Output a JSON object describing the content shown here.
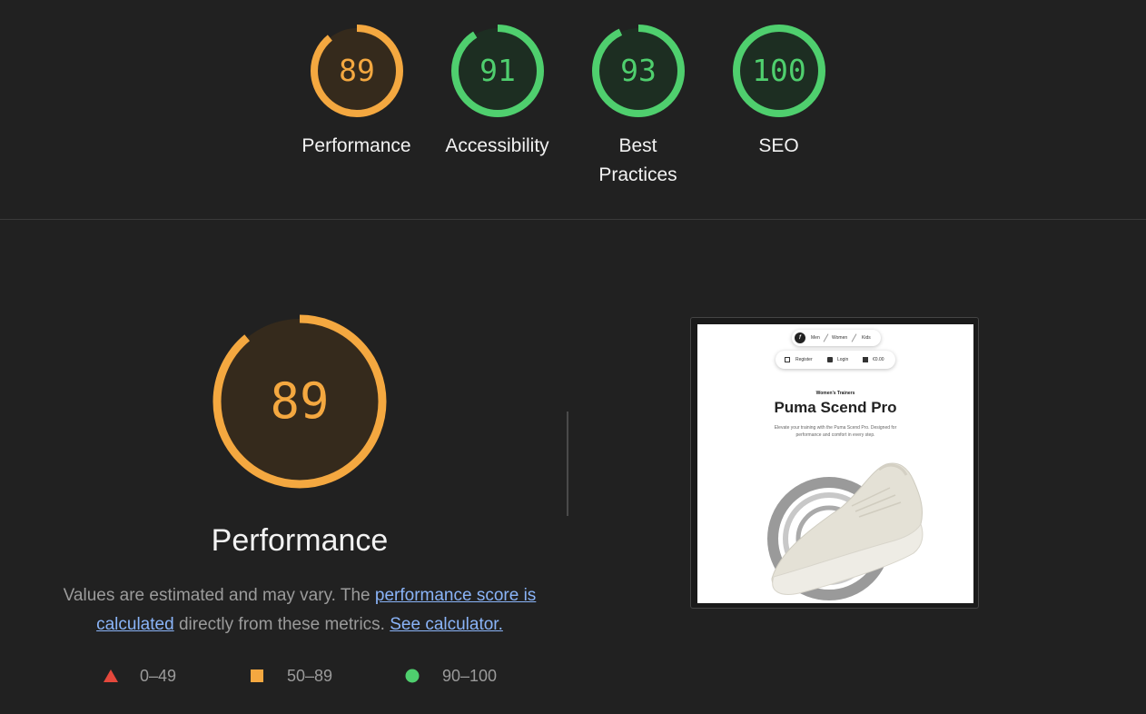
{
  "categories": [
    {
      "label": "Performance",
      "score": 89,
      "color": "#f4a840",
      "fill": "#352a1c",
      "trackPct": 0.89
    },
    {
      "label": "Accessibility",
      "score": 91,
      "color": "#4fcf6e",
      "fill": "#1d2e22",
      "trackPct": 0.91
    },
    {
      "label": "Best Practices",
      "label_line1": "Best",
      "label_line2": "Practices",
      "score": 93,
      "color": "#4fcf6e",
      "fill": "#1d2e22",
      "trackPct": 0.93
    },
    {
      "label": "SEO",
      "score": 100,
      "color": "#4fcf6e",
      "fill": "#1d2e22",
      "trackPct": 1.0
    }
  ],
  "performance": {
    "score": "89",
    "title": "Performance",
    "desc_part1": "Values are estimated and may vary. The ",
    "link_score": "performance score is calculated",
    "desc_part2": " directly from these metrics. ",
    "link_calc": "See calculator."
  },
  "legend": [
    {
      "range": "0–49",
      "shape": "triangle",
      "color": "#e5483c"
    },
    {
      "range": "50–89",
      "shape": "square",
      "color": "#f4a840"
    },
    {
      "range": "90–100",
      "shape": "circle",
      "color": "#4fcf6e"
    }
  ],
  "screenshot": {
    "nav_men": "Men",
    "nav_women": "Women",
    "nav_kids": "Kids",
    "register": "Register",
    "login": "Login",
    "cart": "€0.00",
    "subtitle": "Women's Trainers",
    "title": "Puma Scend Pro",
    "desc": "Elevate your training with the Puma Scend Pro. Designed for performance and comfort in every step."
  },
  "colors": {
    "background": "#212121",
    "average": "#f4a840",
    "pass": "#4fcf6e",
    "fail": "#e5483c",
    "link": "#8ab4f8"
  }
}
